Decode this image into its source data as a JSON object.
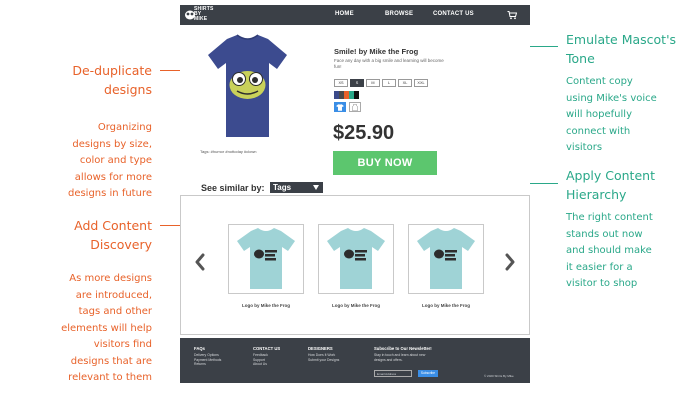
{
  "annotations": {
    "dedup": {
      "title_lines": [
        "De-duplicate",
        "designs"
      ],
      "body_lines": [
        "Organizing",
        "designs by size,",
        "color and type",
        "allows for more",
        "designs in future"
      ]
    },
    "discovery": {
      "title_lines": [
        "Add Content",
        "Discovery"
      ],
      "body_lines": [
        "As more designs",
        "are introduced,",
        "tags and other",
        "elements will help",
        "visitors find",
        "designs that are",
        "relevant to them"
      ]
    },
    "mascot": {
      "title_lines": [
        "Emulate Mascot's",
        "Tone"
      ],
      "body_lines": [
        "Content copy",
        "using Mike's voice",
        "will hopefully",
        "connect with",
        "visitors"
      ]
    },
    "hierarchy": {
      "title_lines": [
        "Apply Content",
        "Hierarchy"
      ],
      "body_lines": [
        "The right content",
        "stands out now",
        "and should make",
        "it easier for a",
        "visitor to shop"
      ]
    },
    "colors": {
      "orange": "#e8622a",
      "teal": "#2aa889"
    }
  },
  "mockup": {
    "logo_lines": [
      "SHIRTS",
      "BY",
      "MIKE"
    ],
    "nav": {
      "home": "HOME",
      "browse": "BROWSE",
      "contact": "CONTACT US",
      "cart_icon": "cart-icon"
    },
    "product": {
      "title": "Smile! by Mike the Frog",
      "description": "Face any day with a big smile and learning will become fun!",
      "sizes": [
        "XS",
        "S",
        "M",
        "L",
        "XL",
        "XXL"
      ],
      "selected_size": "S",
      "colors": [
        "#3b4a8a",
        "#4a4a4a",
        "#e8622a",
        "#2aa889",
        "#111111"
      ],
      "types": [
        "tshirt-icon",
        "tank-icon"
      ],
      "price": "$25.90",
      "buy_label": "BUY NOW",
      "tags": "Tags: #humor #nottoday #clown",
      "shirt_color": "#3c4b8f"
    },
    "similar": {
      "label": "See similar by:",
      "selected": "Tags"
    },
    "carousel": {
      "items": [
        {
          "label": "Logo by Mike the Frog"
        },
        {
          "label": "Logo by Mike the Frog"
        },
        {
          "label": "Logo by Mike the Frog"
        }
      ],
      "shirt_color": "#9fd3d6"
    },
    "footer": {
      "faqs": {
        "head": "FAQs",
        "links": [
          "Delivery Options",
          "Payment Methods",
          "Returns"
        ]
      },
      "contact": {
        "head": "CONTACT US",
        "links": [
          "Feedback",
          "Support",
          "About Us"
        ]
      },
      "designers": {
        "head": "DESIGNERS",
        "links": [
          "How Does It Work",
          "Submit your Designs"
        ]
      },
      "newsletter": {
        "head": "Subscribe to Our Newsletter!",
        "text": "Stay in touch and learn about new designs and offers.",
        "email_placeholder": "Email Address",
        "button": "Subscribe"
      },
      "copyright": "© 2020 Shirts By Mike"
    }
  }
}
